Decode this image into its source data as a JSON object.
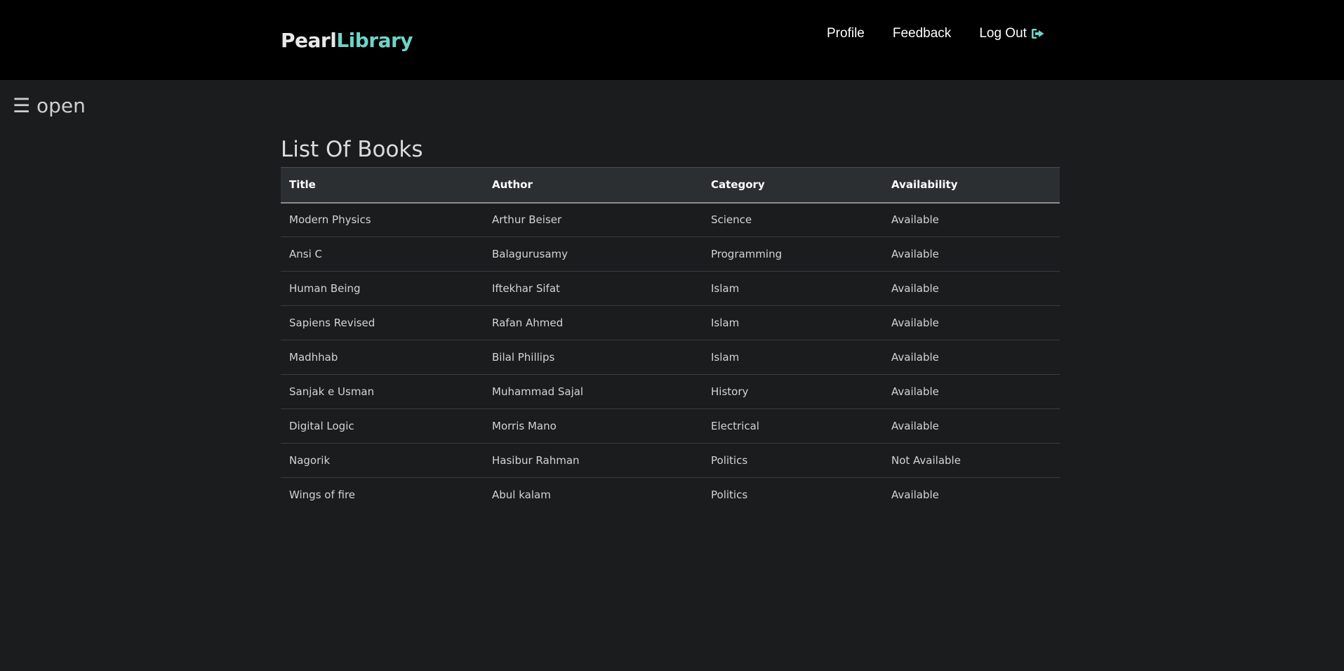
{
  "brand": {
    "part1": "Pearl",
    "part2": "Library"
  },
  "nav": {
    "profile": "Profile",
    "feedback": "Feedback",
    "logout": "Log Out",
    "logout_icon": "sign-out-icon"
  },
  "sidebar_toggle": {
    "label": "☰ open"
  },
  "page": {
    "title": "List Of Books"
  },
  "table": {
    "headers": [
      "Title",
      "Author",
      "Category",
      "Availability"
    ],
    "rows": [
      [
        "Modern Physics",
        "Arthur Beiser",
        "Science",
        "Available"
      ],
      [
        "Ansi C",
        "Balagurusamy",
        "Programming",
        "Available"
      ],
      [
        "Human Being",
        "Iftekhar Sifat",
        "Islam",
        "Available"
      ],
      [
        "Sapiens Revised",
        "Rafan Ahmed",
        "Islam",
        "Available"
      ],
      [
        "Madhhab",
        "Bilal Phillips",
        "Islam",
        "Available"
      ],
      [
        "Sanjak e Usman",
        "Muhammad Sajal",
        "History",
        "Available"
      ],
      [
        "Digital Logic",
        "Morris Mano",
        "Electrical",
        "Available"
      ],
      [
        "Nagorik",
        "Hasibur Rahman",
        "Politics",
        "Not Available"
      ],
      [
        "Wings of fire",
        "Abul kalam",
        "Politics",
        "Available"
      ]
    ]
  },
  "colors": {
    "accent": "#6fd3c6",
    "navbar_bg": "#000000",
    "page_bg": "#1b1c1e",
    "table_header_bg": "#2c2f32"
  }
}
